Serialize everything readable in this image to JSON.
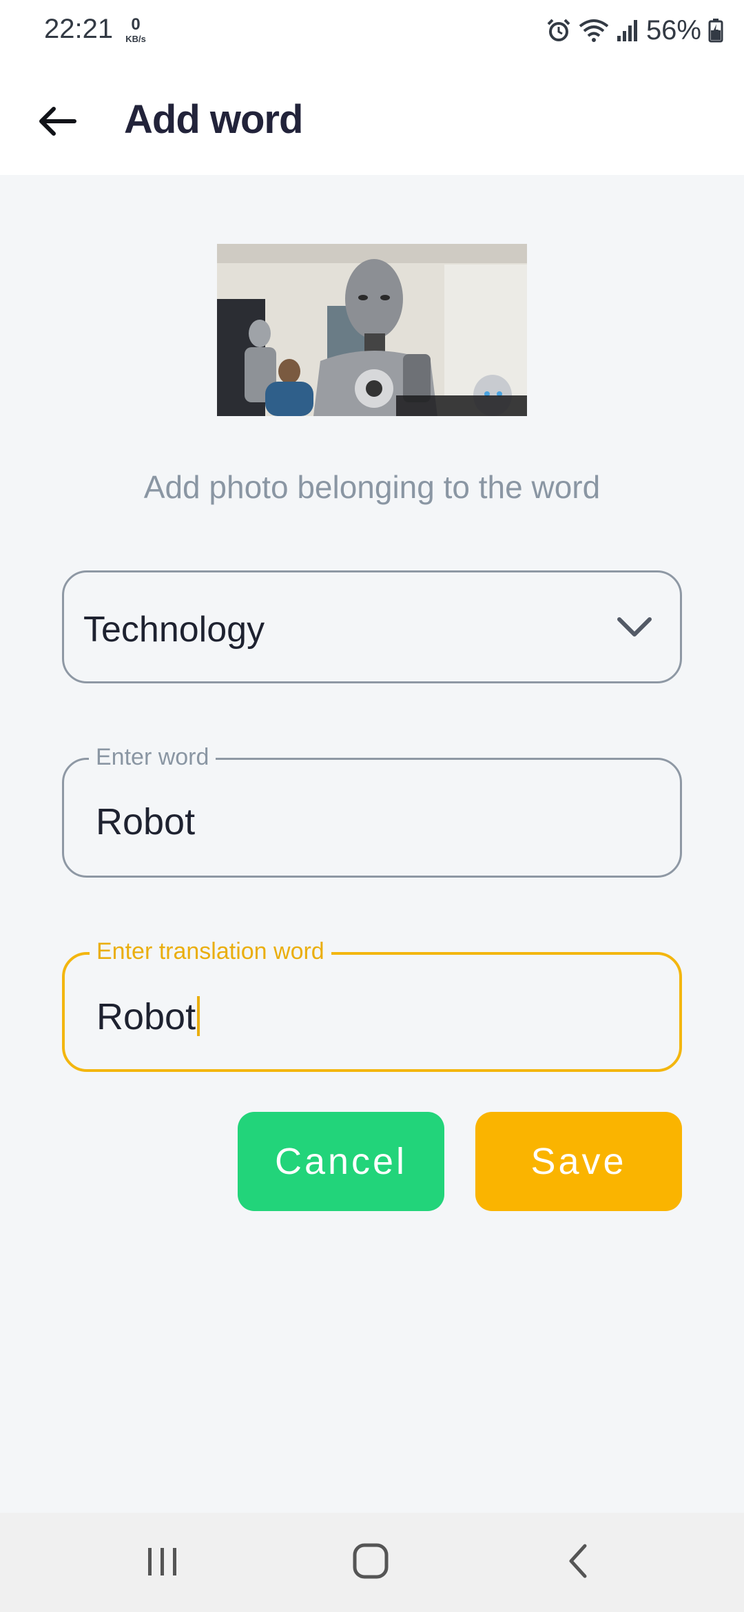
{
  "status_bar": {
    "time": "22:21",
    "net_speed_value": "0",
    "net_speed_unit": "KB/s",
    "battery": "56%"
  },
  "app_bar": {
    "title": "Add word",
    "back_icon": "arrow-left-icon"
  },
  "photo": {
    "hint": "Add photo belonging to the word"
  },
  "form": {
    "category": "Technology",
    "word_label": "Enter word",
    "word_value": "Robot",
    "translation_label": "Enter translation word",
    "translation_value": "Robot"
  },
  "buttons": {
    "cancel": "Cancel",
    "save": "Save"
  },
  "colors": {
    "accent": "#fab400",
    "cancel": "#22d47a",
    "focus_border": "#f3b60f"
  }
}
